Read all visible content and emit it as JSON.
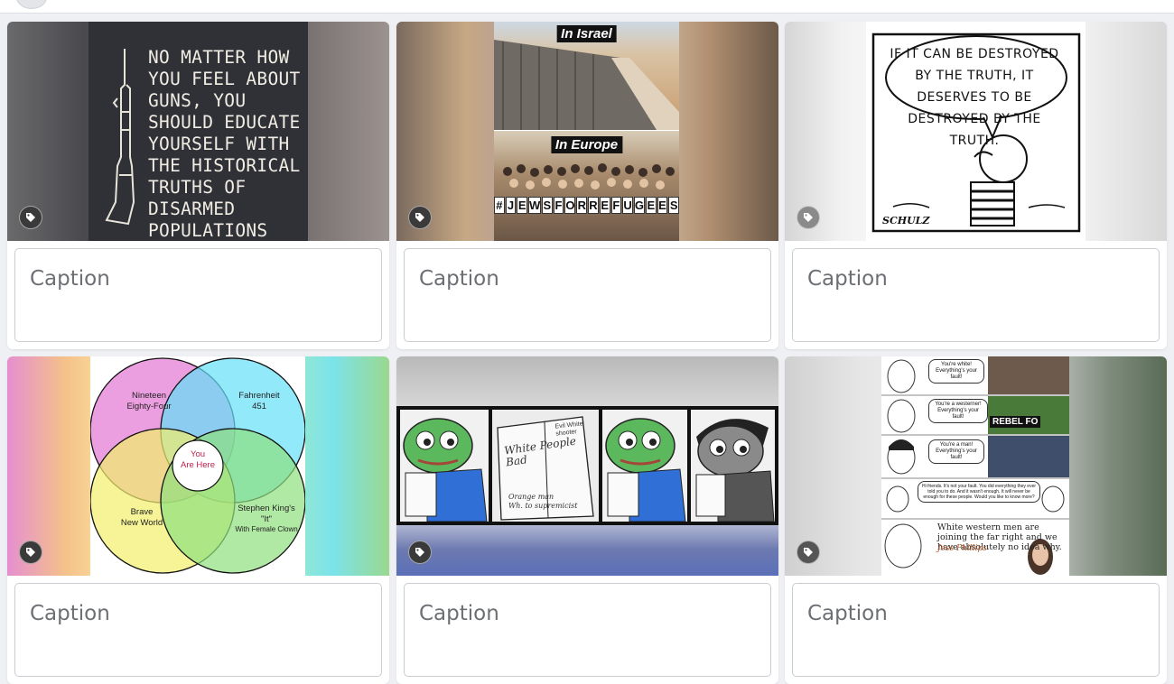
{
  "cards": [
    {
      "caption_placeholder": "Caption",
      "image_text": "NO MATTER HOW\nYOU FEEL ABOUT\nGUNS, YOU\nSHOULD EDUCATE\nYOURSELF WITH\nTHE HISTORICAL\nTRUTHS OF\nDISARMED\nPOPULATIONS"
    },
    {
      "caption_placeholder": "Caption",
      "top_label": "In Israel",
      "bottom_label": "In Europe",
      "sign_letters": [
        "#",
        "J",
        "E",
        "W",
        "S",
        "F",
        "O",
        "R",
        "R",
        "E",
        "F",
        "U",
        "G",
        "E",
        "E",
        "S"
      ]
    },
    {
      "caption_placeholder": "Caption",
      "speech_text": "IF IT CAN BE DESTROYED BY THE TRUTH, IT DESERVES TO BE DESTROYED BY THE TRUTH.",
      "signature": "SCHULZ"
    },
    {
      "caption_placeholder": "Caption",
      "venn": {
        "top_left": "Nineteen\nEighty-Four",
        "top_right": "Fahrenheit\n451",
        "bottom_left": "Brave\nNew World",
        "bottom_right": "Stephen King's\n\"It\"",
        "bottom_right_note": "With Female Clown",
        "center": "You\nAre Here"
      }
    },
    {
      "caption_placeholder": "Caption",
      "paper_text_1": "White People\nBad",
      "paper_text_2": "Orange man\nWh. to supremicist",
      "paper_corner": "Evil White\nshooter"
    },
    {
      "caption_placeholder": "Caption",
      "bubbles": [
        "You're white!\nEverything's your\nfault!",
        "You're a westerner!\nEverything's your\nfault!",
        "You're a man!\nEverything's your\nfault!",
        "Hi friends. It's not your fault. You did everything they ever told you to do. And it wasn't enough. It will never be enough for these people. Would you like to know more?"
      ],
      "banner": "REBEL FO",
      "headline": "White western men are joining the far right and we have absolutely no idea why.",
      "byline": "Jess Phillips"
    }
  ],
  "colors": {
    "page_bg": "#eef0f3",
    "tag_button": "#3a3a3a"
  },
  "icons": [
    "tag-icon"
  ]
}
